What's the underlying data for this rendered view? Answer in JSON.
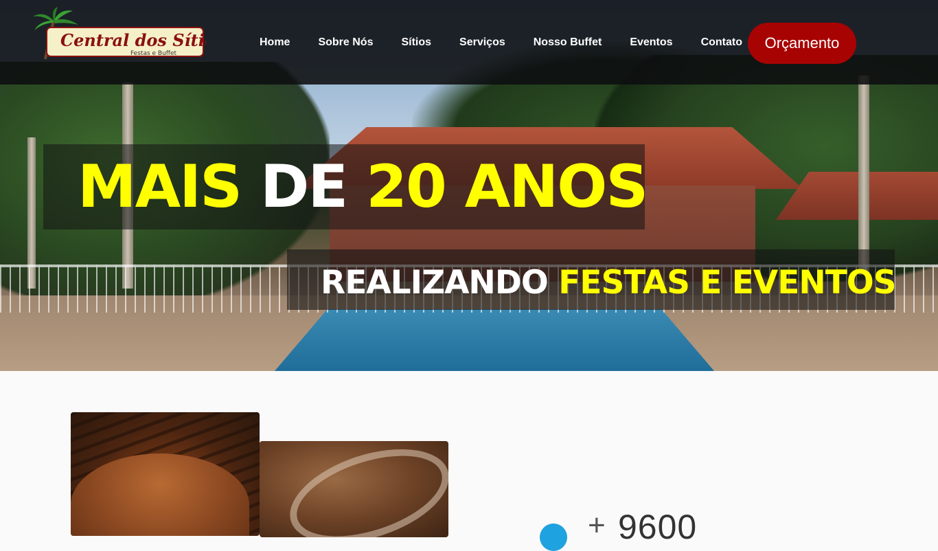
{
  "brand": {
    "name": "Central dos Sítios",
    "tagline": "Festas e Buffet"
  },
  "nav": {
    "items": [
      {
        "label": "Home"
      },
      {
        "label": "Sobre Nós"
      },
      {
        "label": "Sítios"
      },
      {
        "label": "Serviços"
      },
      {
        "label": "Nosso Buffet"
      },
      {
        "label": "Eventos"
      },
      {
        "label": "Contato"
      }
    ],
    "cta_label": "Orçamento"
  },
  "hero": {
    "headline_part1": "MAIS",
    "headline_part2": "DE",
    "headline_part3": "20 ANOS",
    "subline_part1": "REALIZANDO",
    "subline_part2": "FESTAS E EVENTOS"
  },
  "stats": {
    "prefix": "+",
    "value": "9600"
  },
  "colors": {
    "accent_yellow": "#ffff00",
    "cta_red": "#a80303",
    "navbar_bg": "#0c0e10",
    "stat_icon": "#1ea2e0"
  }
}
